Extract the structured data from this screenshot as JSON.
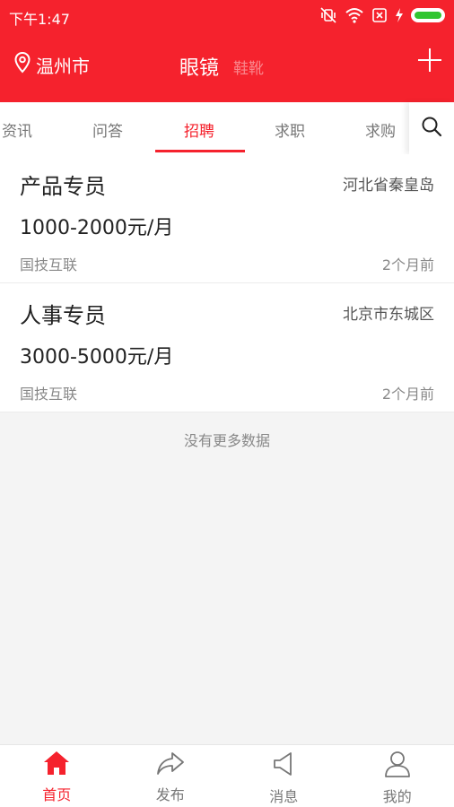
{
  "status_bar": {
    "time": "下午1:47"
  },
  "header": {
    "location": "温州市",
    "title": "眼镜",
    "subtitle": "鞋靴"
  },
  "tabs": [
    {
      "label": "资讯",
      "active": false
    },
    {
      "label": "问答",
      "active": false
    },
    {
      "label": "招聘",
      "active": true
    },
    {
      "label": "求职",
      "active": false
    },
    {
      "label": "求购",
      "active": false
    }
  ],
  "jobs": [
    {
      "title": "产品专员",
      "region": "河北省秦皇岛",
      "salary": "1000-2000元/月",
      "company": "国技互联",
      "time": "2个月前"
    },
    {
      "title": "人事专员",
      "region": "北京市东城区",
      "salary": "3000-5000元/月",
      "company": "国技互联",
      "time": "2个月前"
    }
  ],
  "no_more": "没有更多数据",
  "bottom_nav": [
    {
      "label": "首页",
      "icon": "home-icon",
      "active": true
    },
    {
      "label": "发布",
      "icon": "share-icon",
      "active": false
    },
    {
      "label": "消息",
      "icon": "megaphone-icon",
      "active": false
    },
    {
      "label": "我的",
      "icon": "user-icon",
      "active": false
    }
  ],
  "colors": {
    "accent": "#f5222d",
    "battery": "#31c531"
  }
}
